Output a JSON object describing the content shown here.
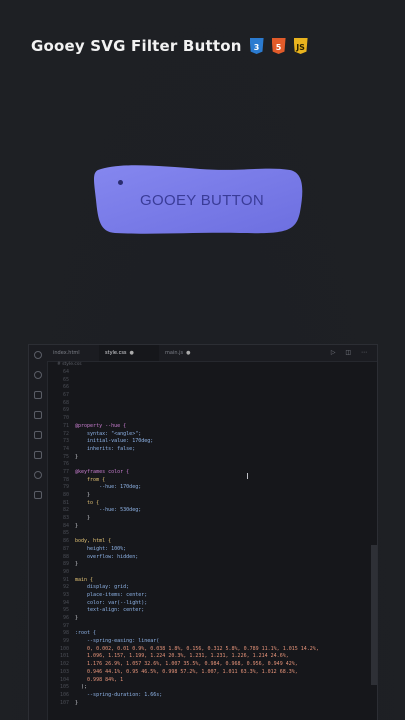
{
  "header": {
    "title": "Gooey SVG Filter Button",
    "badges": [
      "3",
      "5",
      "JS"
    ]
  },
  "demo": {
    "button_label": "GOOEY BUTTON",
    "button_color": "#7b7de8"
  },
  "editor": {
    "tabs": [
      {
        "label": "index.html",
        "active": false
      },
      {
        "label": "style.css",
        "active": true
      },
      {
        "label": "main.js",
        "active": false
      }
    ],
    "breadcrumb": "# style.css",
    "lines": [
      {
        "n": "64",
        "t": ""
      },
      {
        "n": "65",
        "t": ""
      },
      {
        "n": "66",
        "t": ""
      },
      {
        "n": "67",
        "t": ""
      },
      {
        "n": "68",
        "t": ""
      },
      {
        "n": "69",
        "t": ""
      },
      {
        "n": "70",
        "t": ""
      },
      {
        "n": "71",
        "t": "@property --hue {"
      },
      {
        "n": "72",
        "t": "    syntax: \"<angle>\";"
      },
      {
        "n": "73",
        "t": "    initial-value: 170deg;"
      },
      {
        "n": "74",
        "t": "    inherits: false;"
      },
      {
        "n": "75",
        "t": "}"
      },
      {
        "n": "76",
        "t": ""
      },
      {
        "n": "77",
        "t": "@keyframes color {"
      },
      {
        "n": "78",
        "t": "    from {"
      },
      {
        "n": "79",
        "t": "        --hue: 170deg;"
      },
      {
        "n": "80",
        "t": "    }"
      },
      {
        "n": "81",
        "t": "    to {"
      },
      {
        "n": "82",
        "t": "        --hue: 530deg;"
      },
      {
        "n": "83",
        "t": "    }"
      },
      {
        "n": "84",
        "t": "}"
      },
      {
        "n": "85",
        "t": ""
      },
      {
        "n": "86",
        "t": "body, html {"
      },
      {
        "n": "87",
        "t": "    height: 100%;"
      },
      {
        "n": "88",
        "t": "    overflow: hidden;"
      },
      {
        "n": "89",
        "t": "}"
      },
      {
        "n": "90",
        "t": ""
      },
      {
        "n": "91",
        "t": "main {"
      },
      {
        "n": "92",
        "t": "    display: grid;"
      },
      {
        "n": "93",
        "t": "    place-items: center;"
      },
      {
        "n": "94",
        "t": "    color: var(--light);"
      },
      {
        "n": "95",
        "t": "    text-align: center;"
      },
      {
        "n": "96",
        "t": "}"
      },
      {
        "n": "97",
        "t": ""
      },
      {
        "n": "98",
        "t": ":root {"
      },
      {
        "n": "99",
        "t": "    --spring-easing: linear("
      },
      {
        "n": "100",
        "t": "    0, 0.002, 0.01 0.9%, 0.038 1.8%, 0.156, 0.312 5.8%, 0.789 11.1%, 1.015 14.2%,"
      },
      {
        "n": "101",
        "t": "    1.096, 1.157, 1.199, 1.224 20.3%, 1.231, 1.231, 1.226, 1.214 24.6%,"
      },
      {
        "n": "102",
        "t": "    1.176 26.9%, 1.057 32.6%, 1.007 35.5%, 0.984, 0.968, 0.956, 0.949 42%,"
      },
      {
        "n": "103",
        "t": "    0.946 44.1%, 0.95 46.5%, 0.998 57.2%, 1.007, 1.011 63.3%, 1.012 68.3%,"
      },
      {
        "n": "104",
        "t": "    0.998 84%, 1"
      },
      {
        "n": "105",
        "t": "  );"
      },
      {
        "n": "106",
        "t": "    --spring-duration: 1.66s;"
      },
      {
        "n": "107",
        "t": "}"
      }
    ]
  }
}
